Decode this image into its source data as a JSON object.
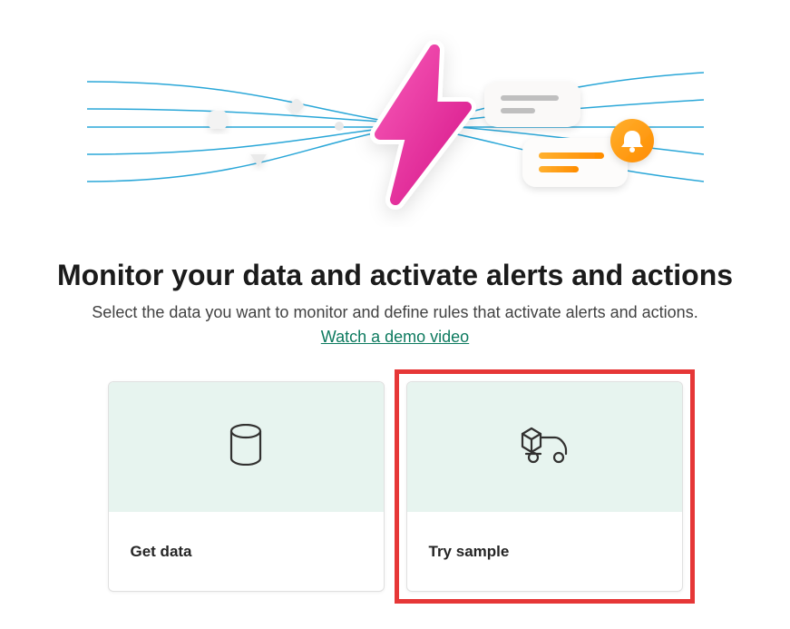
{
  "heading": "Monitor your data and activate alerts and actions",
  "subtitle": "Select the data you want to monitor and define rules that activate alerts and actions.",
  "video_link_label": "Watch a demo video",
  "cards": {
    "get_data": {
      "label": "Get data"
    },
    "try_sample": {
      "label": "Try sample"
    }
  },
  "illustration": {
    "icons": [
      "lightning-icon",
      "notification-bell-icon",
      "chat-card-icon"
    ]
  }
}
